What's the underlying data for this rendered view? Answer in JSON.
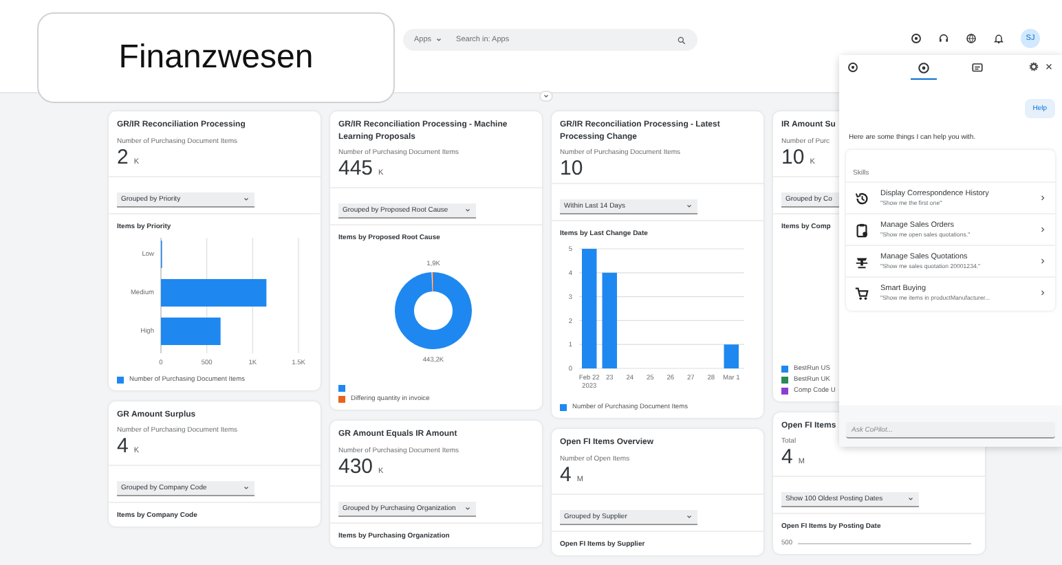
{
  "title_badge": "Finanzwesen",
  "shell": {
    "search_scope": "Apps",
    "search_placeholder": "Search in: Apps",
    "avatar": "SJ",
    "actions": [
      {
        "kind": "copilot"
      },
      {
        "kind": "headset"
      },
      {
        "kind": "globe"
      },
      {
        "kind": "bell"
      }
    ]
  },
  "columns": [
    [
      {
        "kind": "chart",
        "title": "GR/IR Reconciliation Processing",
        "subtitle": "Number of Purchasing Document Items",
        "value": "2",
        "unit": "K",
        "dropdown": "Grouped by Priority",
        "section_title": "Items by Priority",
        "chart_data": {
          "type": "bar",
          "orientation": "horizontal",
          "grid": true,
          "categories": [
            "Low",
            "Medium",
            "High"
          ],
          "xlim": [
            0,
            1500
          ],
          "xticks": [
            0,
            500,
            {
              "value": 1000,
              "label": "1K"
            },
            {
              "value": 1500,
              "label": "1.5K"
            }
          ],
          "series": [
            {
              "name": "Number of Purchasing Document Items",
              "color": "#1e88f0",
              "values": [
                10,
                1150,
                650
              ]
            }
          ]
        }
      },
      {
        "kind": "plain",
        "title": "GR Amount Surplus",
        "subtitle": "Number of Purchasing Document Items",
        "value": "4",
        "unit": "K",
        "dropdown": "Grouped by Company Code",
        "section_title": "Items by Company Code"
      }
    ],
    [
      {
        "kind": "chart",
        "title": "GR/IR Reconciliation Processing - Machine Learning Proposals",
        "subtitle": "Number of Purchasing Document Items",
        "value": "445",
        "unit": "K",
        "dropdown": "Grouped by Proposed Root Cause",
        "section_title": "Items by Proposed Root Cause",
        "chart_data": {
          "type": "donut",
          "values": [
            443.2,
            1.9
          ],
          "value_labels": [
            "443,2K",
            "1,9K"
          ]
        },
        "legend": [
          {
            "color": "#1e88f0"
          },
          {
            "label": "Differing quantity in invoice",
            "color": "#e8641b"
          }
        ]
      },
      {
        "kind": "plain",
        "title": "GR Amount Equals IR Amount",
        "subtitle": "Number of Purchasing Document Items",
        "value": "430",
        "unit": "K",
        "dropdown": "Grouped by Purchasing Organization",
        "section_title": "Items by Purchasing Organization"
      }
    ],
    [
      {
        "kind": "chart",
        "title": "GR/IR Reconciliation Processing - Latest Processing Change",
        "subtitle": "Number of Purchasing Document Items",
        "value": "10",
        "dropdown": "Within Last 14 Days",
        "section_title": "Items by Last Change Date",
        "chart_data": {
          "type": "bar",
          "orientation": "vertical",
          "grid": true,
          "categories": [
            "Feb 22\n2023",
            "23",
            "24",
            "25",
            "26",
            "27",
            "28",
            "Mar 1"
          ],
          "ylim": [
            0,
            5
          ],
          "yticks": [
            0,
            1,
            2,
            3,
            4,
            5
          ],
          "series": [
            {
              "name": "Number of Purchasing Document Items",
              "color": "#1e88f0",
              "values": [
                5,
                4,
                0,
                0,
                0,
                0,
                0,
                1
              ]
            }
          ]
        }
      },
      {
        "kind": "plain",
        "title": "Open FI Items Overview",
        "subtitle": "Number of Open Items",
        "value": "4",
        "unit": "M",
        "dropdown": "Grouped by Supplier",
        "section_title": "Open FI Items by Supplier"
      }
    ],
    [
      {
        "kind": "legend",
        "title": "IR Amount Su",
        "subtitle": "Number of Purc",
        "value": "10",
        "unit": "K",
        "dropdown": "Grouped by Co",
        "section_title": "Items by Comp",
        "legend": [
          {
            "label": "BestRun US",
            "color": "#1e88f0"
          },
          {
            "label": "BestRun UK",
            "color": "#2a8a5a"
          },
          {
            "label": "Comp Code U",
            "color": "#8a3fd1"
          }
        ]
      },
      {
        "kind": "axis",
        "title": "Open FI Items",
        "subtitle": "Total",
        "value": "4",
        "unit": "M",
        "dropdown": "Show 100 Oldest Posting Dates",
        "section_title": "Open FI Items by Posting Date",
        "axis_tick": "500"
      }
    ]
  ],
  "copilot": {
    "tabs": [
      {
        "kind": "copilot",
        "selected": true
      },
      {
        "kind": "chat",
        "selected": false
      }
    ],
    "help_bubble": "Help",
    "intro": "Here are some things I can help you with.",
    "skills_title": "Skills",
    "skills": [
      {
        "kind": "history",
        "title": "Display Correspondence History",
        "example": "\"Show me the first one\""
      },
      {
        "kind": "clipboard",
        "title": "Manage Sales Orders",
        "example": "\"Show me open sales quotations.\""
      },
      {
        "kind": "lectern",
        "title": "Manage Sales Quotations",
        "example": "\"Show me sales quotation 20001234.\""
      },
      {
        "kind": "cart",
        "title": "Smart Buying",
        "example": "\"Show me items in productManufacturer..."
      }
    ],
    "input_placeholder": "Ask CoPilot..."
  }
}
